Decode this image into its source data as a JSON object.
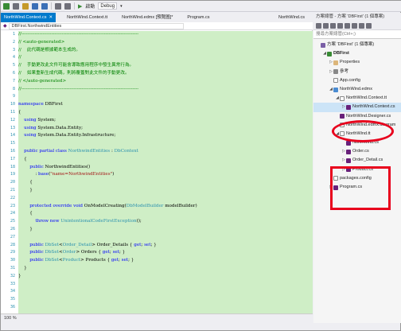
{
  "toolbar": {
    "run_label": "啟動",
    "config_label": "Debug"
  },
  "tabs": [
    {
      "label": "NorthWind.Context.cs",
      "active": true
    },
    {
      "label": "NorthWind.Context.tt",
      "active": false
    },
    {
      "label": "NorthWind.edmx [預覽圖]*",
      "active": false
    },
    {
      "label": "Program.cs",
      "active": false
    },
    {
      "label": "NorthWind.cs",
      "active": false
    }
  ],
  "navbar": {
    "scope": "DBFirst.NorthwindEntities"
  },
  "code": {
    "line_numbers": [
      "1",
      "2",
      "3",
      "4",
      "5",
      "6",
      "7",
      "8",
      "9",
      "10",
      "11",
      "12",
      "13",
      "14",
      "15",
      "16",
      "17",
      "18",
      "19",
      "20",
      "21",
      "22",
      "23",
      "24",
      "25",
      "26",
      "27",
      "28",
      "29",
      "30",
      "31",
      "32",
      "33",
      "34",
      "35",
      "36"
    ],
    "lines": [
      [
        {
          "t": "//------------------------------------------------------------------------------",
          "c": "c-comment"
        }
      ],
      [
        {
          "t": "// <auto-generated>",
          "c": "c-comment"
        }
      ],
      [
        {
          "t": "//    此代碼是根據範本生成的。",
          "c": "c-comment"
        }
      ],
      [
        {
          "t": "//",
          "c": "c-comment"
        }
      ],
      [
        {
          "t": "//    手動更改此文件可能會導致應用程序中發生異常行為。",
          "c": "c-comment"
        }
      ],
      [
        {
          "t": "//    如果重新生成代碼，則將覆蓋對此文件的手動更改。",
          "c": "c-comment"
        }
      ],
      [
        {
          "t": "// </auto-generated>",
          "c": "c-comment"
        }
      ],
      [
        {
          "t": "//------------------------------------------------------------------------------",
          "c": "c-comment"
        }
      ],
      [
        {
          "t": "",
          "c": "c-plain"
        }
      ],
      [
        {
          "t": "namespace",
          "c": "c-kw"
        },
        {
          "t": " DBFirst",
          "c": "c-plain"
        }
      ],
      [
        {
          "t": "{",
          "c": "c-plain"
        }
      ],
      [
        {
          "t": "    using",
          "c": "c-kw"
        },
        {
          "t": " System;",
          "c": "c-plain"
        }
      ],
      [
        {
          "t": "    using",
          "c": "c-kw"
        },
        {
          "t": " System.Data.Entity;",
          "c": "c-plain"
        }
      ],
      [
        {
          "t": "    using",
          "c": "c-kw"
        },
        {
          "t": " System.Data.Entity.Infrastructure;",
          "c": "c-plain"
        }
      ],
      [
        {
          "t": "",
          "c": "c-plain"
        }
      ],
      [
        {
          "t": "    public partial class",
          "c": "c-kw"
        },
        {
          "t": " NorthwindEntities",
          "c": "c-type"
        },
        {
          "t": " : ",
          "c": "c-plain"
        },
        {
          "t": "DbContext",
          "c": "c-type"
        }
      ],
      [
        {
          "t": "    {",
          "c": "c-plain"
        }
      ],
      [
        {
          "t": "        public",
          "c": "c-kw"
        },
        {
          "t": " NorthwindEntities()",
          "c": "c-plain"
        }
      ],
      [
        {
          "t": "            : ",
          "c": "c-plain"
        },
        {
          "t": "base",
          "c": "c-kw"
        },
        {
          "t": "(",
          "c": "c-plain"
        },
        {
          "t": "\"name=NorthwindEntities\"",
          "c": "c-str"
        },
        {
          "t": ")",
          "c": "c-plain"
        }
      ],
      [
        {
          "t": "        {",
          "c": "c-plain"
        }
      ],
      [
        {
          "t": "        }",
          "c": "c-plain"
        }
      ],
      [
        {
          "t": "",
          "c": "c-plain"
        }
      ],
      [
        {
          "t": "        protected override void",
          "c": "c-kw"
        },
        {
          "t": " OnModelCreating(",
          "c": "c-plain"
        },
        {
          "t": "DbModelBuilder",
          "c": "c-type"
        },
        {
          "t": " modelBuilder)",
          "c": "c-plain"
        }
      ],
      [
        {
          "t": "        {",
          "c": "c-plain"
        }
      ],
      [
        {
          "t": "            throw new",
          "c": "c-kw"
        },
        {
          "t": " ",
          "c": "c-plain"
        },
        {
          "t": "UnintentionalCodeFirstException",
          "c": "c-type"
        },
        {
          "t": "();",
          "c": "c-plain"
        }
      ],
      [
        {
          "t": "        }",
          "c": "c-plain"
        }
      ],
      [
        {
          "t": "",
          "c": "c-plain"
        }
      ],
      [
        {
          "t": "        public",
          "c": "c-kw"
        },
        {
          "t": " ",
          "c": "c-plain"
        },
        {
          "t": "DbSet",
          "c": "c-type"
        },
        {
          "t": "<",
          "c": "c-plain"
        },
        {
          "t": "Order_Detail",
          "c": "c-type"
        },
        {
          "t": "> Order_Details { ",
          "c": "c-plain"
        },
        {
          "t": "get",
          "c": "c-kw"
        },
        {
          "t": "; ",
          "c": "c-plain"
        },
        {
          "t": "set",
          "c": "c-kw"
        },
        {
          "t": "; }",
          "c": "c-plain"
        }
      ],
      [
        {
          "t": "        public",
          "c": "c-kw"
        },
        {
          "t": " ",
          "c": "c-plain"
        },
        {
          "t": "DbSet",
          "c": "c-type"
        },
        {
          "t": "<",
          "c": "c-plain"
        },
        {
          "t": "Order",
          "c": "c-type"
        },
        {
          "t": "> Orders { ",
          "c": "c-plain"
        },
        {
          "t": "get",
          "c": "c-kw"
        },
        {
          "t": "; ",
          "c": "c-plain"
        },
        {
          "t": "set",
          "c": "c-kw"
        },
        {
          "t": "; }",
          "c": "c-plain"
        }
      ],
      [
        {
          "t": "        public",
          "c": "c-kw"
        },
        {
          "t": " ",
          "c": "c-plain"
        },
        {
          "t": "DbSet",
          "c": "c-type"
        },
        {
          "t": "<",
          "c": "c-plain"
        },
        {
          "t": "Product",
          "c": "c-type"
        },
        {
          "t": "> Products { ",
          "c": "c-plain"
        },
        {
          "t": "get",
          "c": "c-kw"
        },
        {
          "t": "; ",
          "c": "c-plain"
        },
        {
          "t": "set",
          "c": "c-kw"
        },
        {
          "t": "; }",
          "c": "c-plain"
        }
      ],
      [
        {
          "t": "    }",
          "c": "c-plain"
        }
      ],
      [
        {
          "t": "}",
          "c": "c-plain"
        }
      ],
      [
        {
          "t": "",
          "c": "c-plain"
        }
      ],
      [
        {
          "t": "",
          "c": "c-plain"
        }
      ],
      [
        {
          "t": "",
          "c": "c-plain"
        }
      ],
      [
        {
          "t": "",
          "c": "c-plain"
        }
      ]
    ]
  },
  "statusbar": {
    "zoom": "100 %"
  },
  "explorer": {
    "title": "方案總管 - 方案 'DBFirst' (1 個專案)",
    "search_placeholder": "搜尋方案總管(Ctrl+;)",
    "nodes": [
      {
        "label": "方案 'DBFirst' (1 個專案)",
        "indent": 0,
        "arrow": "",
        "icon": "sol",
        "name": "tree-item-solution"
      },
      {
        "label": "DBFirst",
        "indent": 1,
        "arrow": "◢",
        "icon": "proj",
        "name": "tree-item-project",
        "bold": true
      },
      {
        "label": "Properties",
        "indent": 2,
        "arrow": "▷",
        "icon": "folder",
        "name": "tree-item-properties"
      },
      {
        "label": "參考",
        "indent": 2,
        "arrow": "▷",
        "icon": "ref",
        "name": "tree-item-references"
      },
      {
        "label": "App.config",
        "indent": 2,
        "arrow": "",
        "icon": "file",
        "name": "tree-item-app-config"
      },
      {
        "label": "NorthWind.edmx",
        "indent": 2,
        "arrow": "◢",
        "icon": "edmx",
        "name": "tree-item-northwind-edmx"
      },
      {
        "label": "NorthWind.Context.tt",
        "indent": 3,
        "arrow": "◢",
        "icon": "file",
        "name": "tree-item-context-tt"
      },
      {
        "label": "NorthWind.Context.cs",
        "indent": 4,
        "arrow": "▷",
        "icon": "cs",
        "name": "tree-item-context-cs",
        "selected": true
      },
      {
        "label": "NorthWind.Designer.cs",
        "indent": 3,
        "arrow": "",
        "icon": "cs",
        "name": "tree-item-designer-cs"
      },
      {
        "label": "NorthWind.edmx.diagram",
        "indent": 3,
        "arrow": "",
        "icon": "file",
        "name": "tree-item-edmx-diagram"
      },
      {
        "label": "NorthWind.tt",
        "indent": 3,
        "arrow": "◢",
        "icon": "file",
        "name": "tree-item-northwind-tt"
      },
      {
        "label": "NorthWind.cs",
        "indent": 4,
        "arrow": "",
        "icon": "cs",
        "name": "tree-item-northwind-cs"
      },
      {
        "label": "Order.cs",
        "indent": 4,
        "arrow": "▷",
        "icon": "cs",
        "name": "tree-item-order-cs"
      },
      {
        "label": "Order_Detail.cs",
        "indent": 4,
        "arrow": "▷",
        "icon": "cs",
        "name": "tree-item-order-detail-cs"
      },
      {
        "label": "Product.cs",
        "indent": 4,
        "arrow": "▷",
        "icon": "cs",
        "name": "tree-item-product-cs"
      },
      {
        "label": "packages.config",
        "indent": 2,
        "arrow": "",
        "icon": "file",
        "name": "tree-item-packages-config"
      },
      {
        "label": "Program.cs",
        "indent": 2,
        "arrow": "▷",
        "icon": "cs",
        "name": "tree-item-program-cs"
      }
    ]
  },
  "colors": {
    "accent": "#007acc",
    "code_background": "#cfeec6",
    "annotation_red": "#e8001c"
  }
}
